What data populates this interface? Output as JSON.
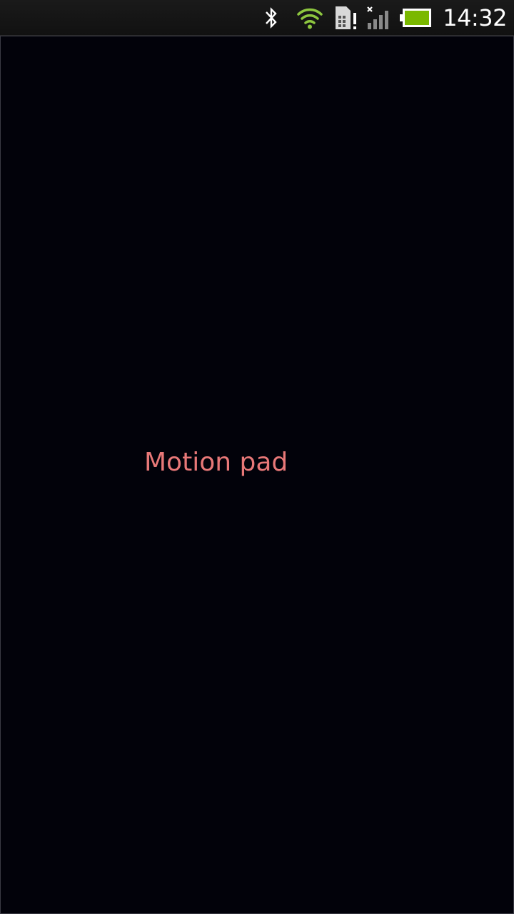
{
  "status_bar": {
    "time": "14:32",
    "icons": [
      "bluetooth-icon",
      "wifi-icon",
      "sim-card-alert-icon",
      "signal-no-service-icon",
      "battery-icon"
    ],
    "colors": {
      "wifi": "#8dc63f",
      "battery": "#7ab800"
    }
  },
  "pad": {
    "label": "Motion pad",
    "label_color": "#e87878",
    "background": "#02020a"
  }
}
